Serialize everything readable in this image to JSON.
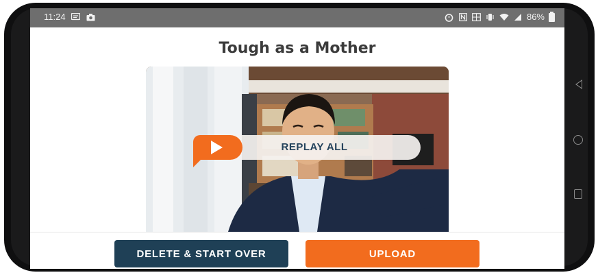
{
  "status_bar": {
    "time": "11:24",
    "battery": "86%",
    "left_icons": [
      "message-icon",
      "camera-icon"
    ],
    "right_icons": [
      "alarm-icon",
      "nfc-icon",
      "data-icon",
      "vibrate-icon",
      "wifi-icon",
      "signal-icon",
      "battery-icon"
    ]
  },
  "page": {
    "title": "Tough as a Mother"
  },
  "video": {
    "replay_label": "REPLAY ALL",
    "play_icon": "play-icon"
  },
  "actions": {
    "delete_label": "DELETE & START OVER",
    "upload_label": "UPLOAD"
  },
  "colors": {
    "accent": "#f26c1e",
    "primary_dark": "#1f4056",
    "replay_text": "#25435c",
    "status_bar": "#6e6e6e"
  },
  "nav": {
    "icons": [
      "back-icon",
      "home-icon",
      "recents-icon"
    ]
  }
}
